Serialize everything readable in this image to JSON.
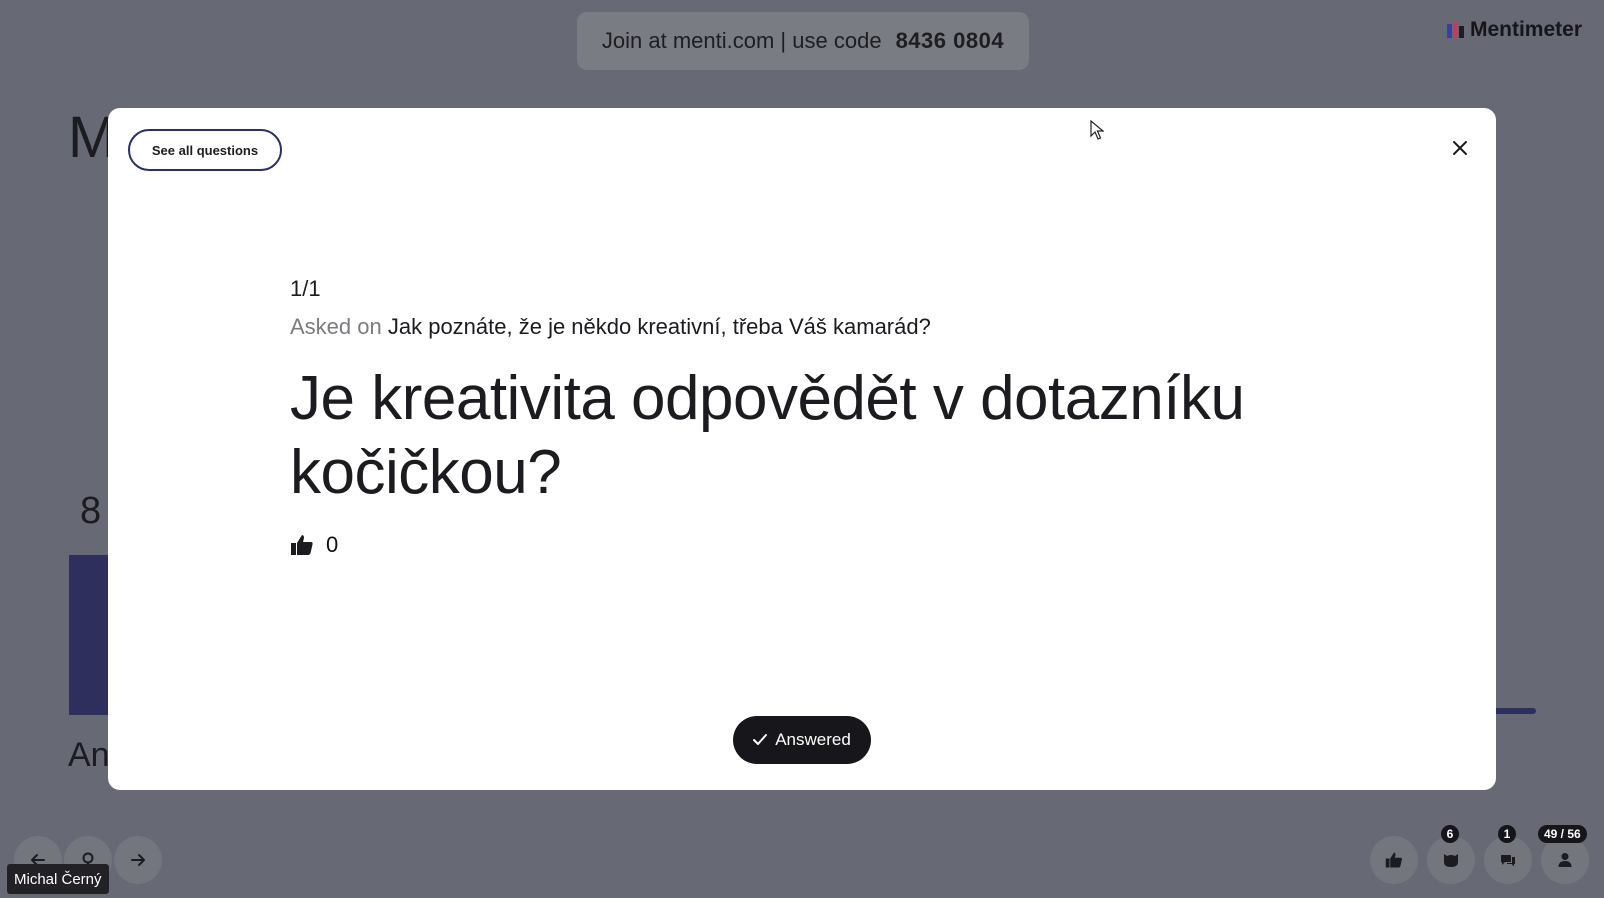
{
  "join": {
    "text": "Join at menti.com | use code",
    "code": "8436 0804"
  },
  "brand": {
    "name": "Mentimeter"
  },
  "background": {
    "title_partial": "M",
    "number_partial": "8",
    "label_partial": "An"
  },
  "modal": {
    "see_all_label": "See all questions",
    "counter": "1/1",
    "asked_prefix": "Asked on",
    "asked_slide": "Jak poznáte, že je někdo kreativní, třeba Váš kamarád?",
    "question_line1": "Je kreativita odpovědět v dotazníku",
    "question_line2": "kočičkou?",
    "votes": "0",
    "answered_label": "Answered"
  },
  "controls": {
    "qa_badge": "6",
    "comments_badge": "1",
    "slide_counter": "49 / 56"
  },
  "presenter": {
    "name": "Michal Černý"
  },
  "colors": {
    "accent": "#2c2f62",
    "dark_button": "#16161b"
  },
  "icons": [
    "close-icon",
    "thumbs-up-icon",
    "check-icon",
    "arrow-left-icon",
    "arrow-right-icon",
    "pin-icon",
    "qa-icon",
    "comments-icon",
    "person-icon"
  ]
}
